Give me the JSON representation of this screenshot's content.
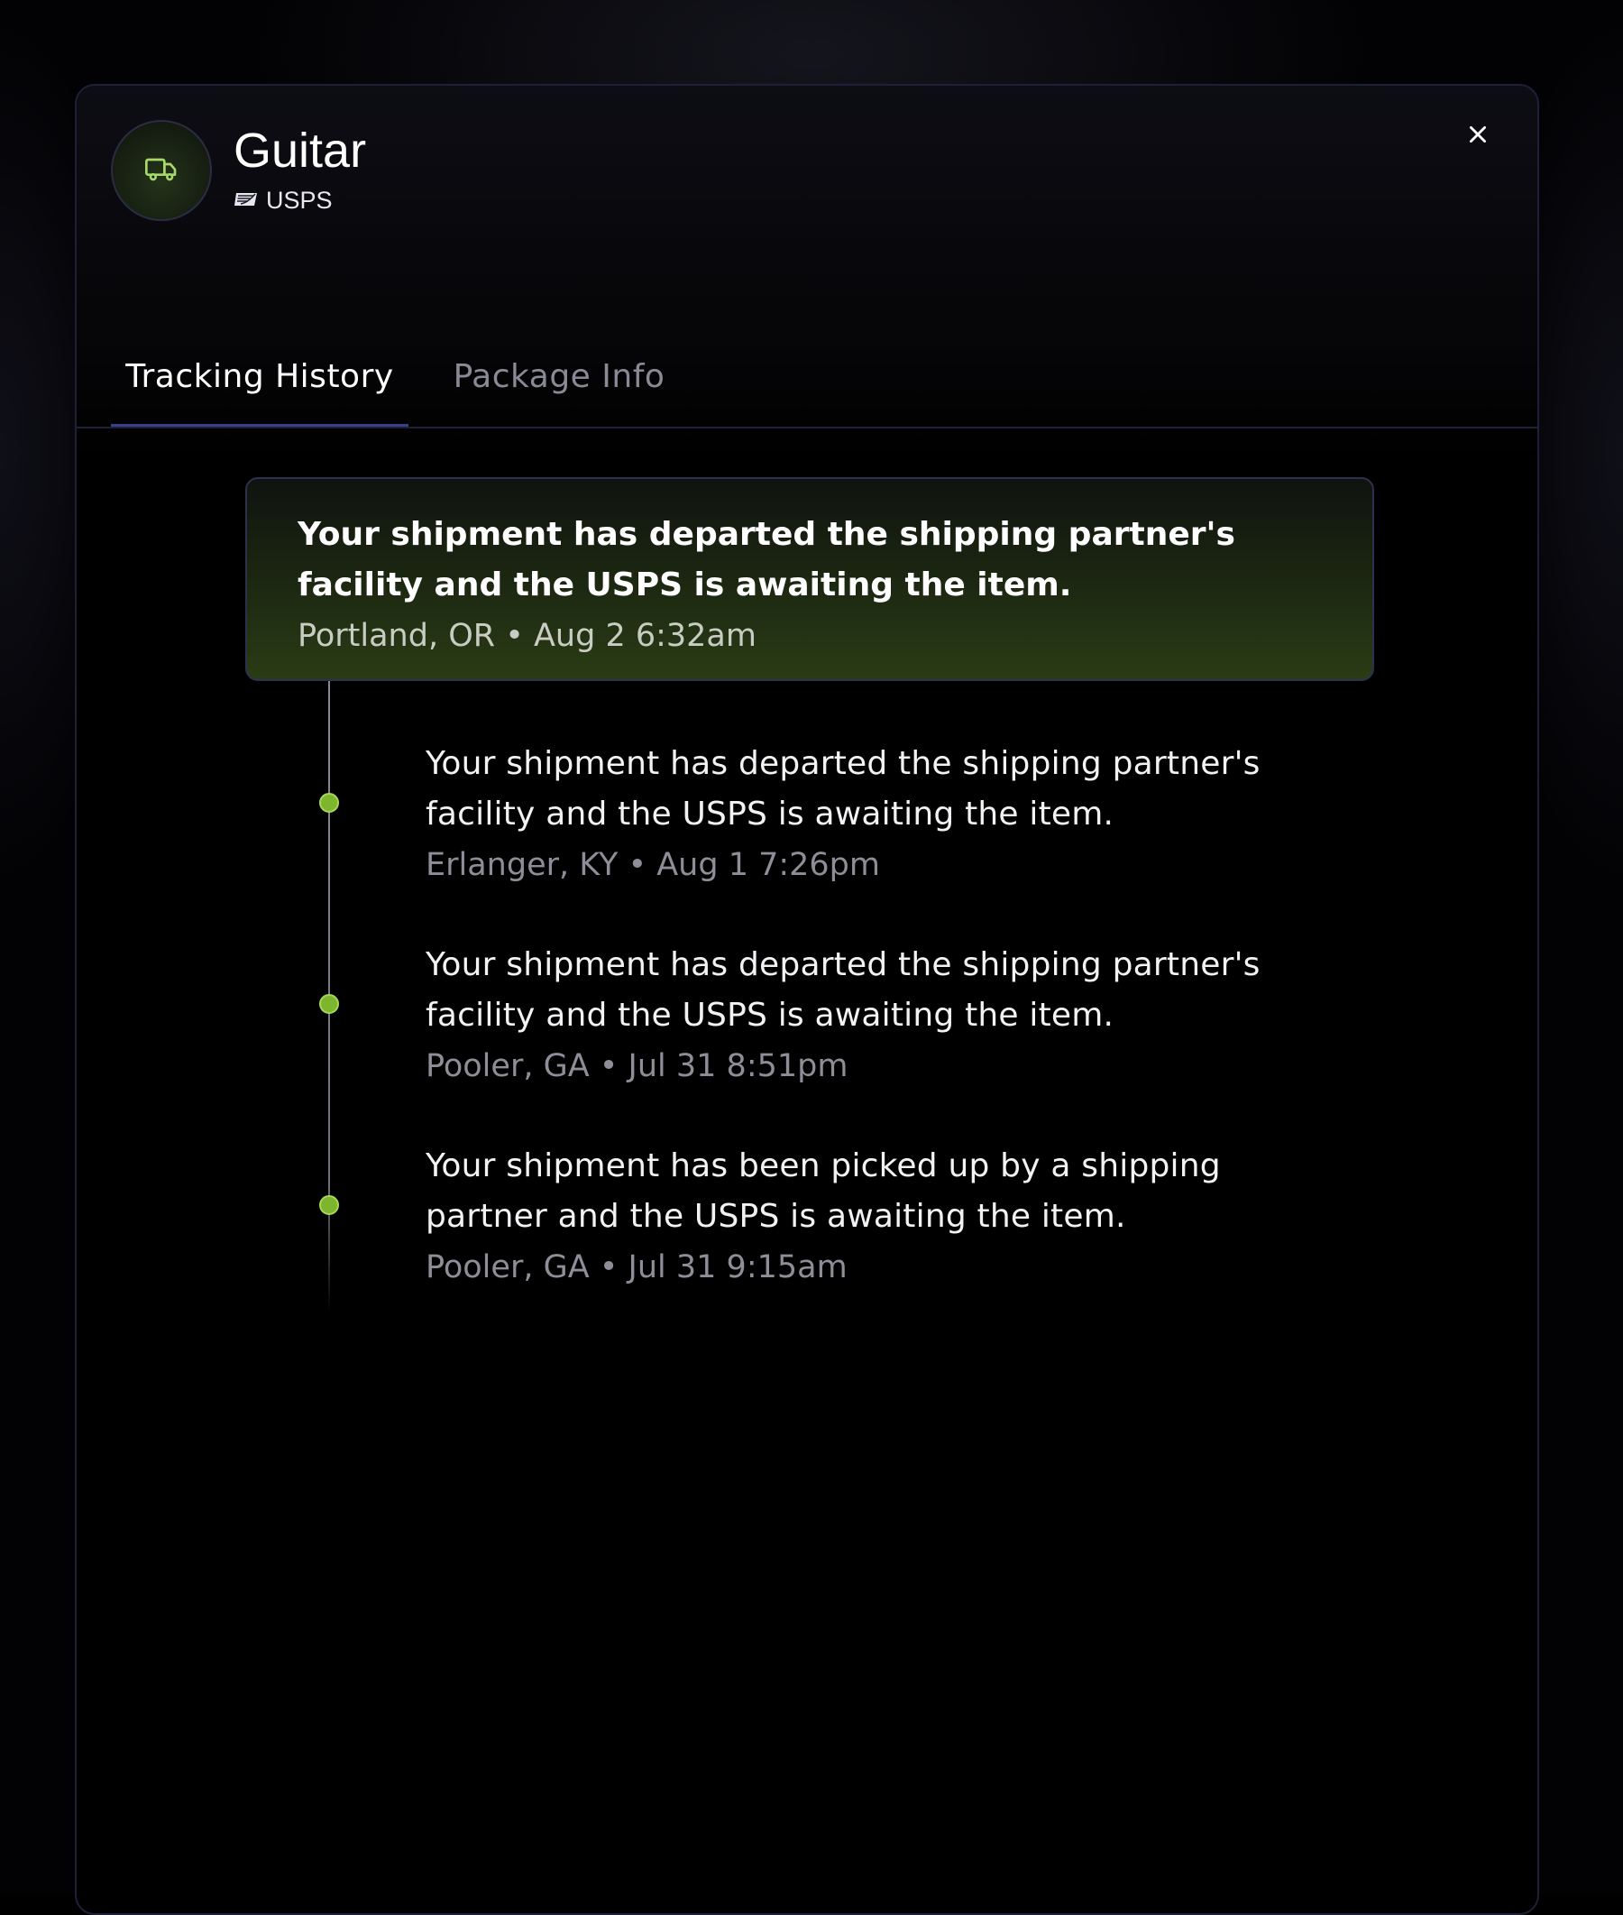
{
  "package": {
    "name": "Guitar",
    "carrier": "USPS",
    "icon": "truck-icon",
    "carrier_icon": "usps-logo-icon"
  },
  "close_icon": "close-icon",
  "tabs": [
    {
      "label": "Tracking History",
      "active": true
    },
    {
      "label": "Package Info",
      "active": false
    }
  ],
  "tracking": {
    "latest": {
      "description": "Your shipment has departed the shipping partner's facility and the USPS is awaiting the item.",
      "location": "Portland, OR",
      "time": "Aug 2 6:32am",
      "meta": "Portland, OR • Aug 2 6:32am"
    },
    "events": [
      {
        "description": "Your shipment has departed the shipping partner's facility and the USPS is awaiting the item.",
        "location": "Erlanger, KY",
        "time": "Aug 1 7:26pm",
        "meta": "Erlanger, KY • Aug 1 7:26pm"
      },
      {
        "description": "Your shipment has departed the shipping partner's facility and the USPS is awaiting the item.",
        "location": "Pooler, GA",
        "time": "Jul 31 8:51pm",
        "meta": "Pooler, GA • Jul 31 8:51pm"
      },
      {
        "description": "Your shipment has been picked up by a shipping partner and the USPS is awaiting the item.",
        "location": "Pooler, GA",
        "time": "Jul 31 9:15am",
        "meta": "Pooler, GA • Jul 31 9:15am"
      }
    ]
  },
  "colors": {
    "accent_green": "#7db52e",
    "tab_underline": "#3a3f8a",
    "border": "#1e1f38"
  }
}
